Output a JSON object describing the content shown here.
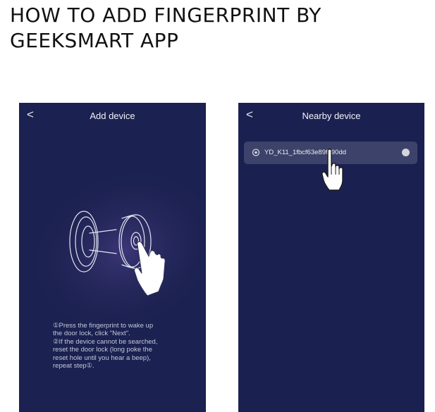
{
  "heading": {
    "line1": "HOW TO ADD FINGERPRINT BY",
    "line2": "GEEKSMART APP"
  },
  "screen_add_device": {
    "back_icon": "chevron-left",
    "back_glyph": "<",
    "title": "Add device",
    "instructions": "①Press the fingerprint to wake up\nthe door lock, click \"Next\".\n②If the device cannot be searched,\nreset the door lock (long poke the\nreset hole until you hear a beep),\nrepeat step①."
  },
  "screen_nearby_device": {
    "back_icon": "chevron-left",
    "back_glyph": "<",
    "title": "Nearby device",
    "devices": [
      {
        "name": "YD_K11_1fbcf63e89f290dd",
        "icon": "lock-icon",
        "selected": false
      }
    ]
  },
  "colors": {
    "screen_bg": "#1b2150",
    "row_bg": "#3c4269",
    "text": "#ffffff"
  }
}
